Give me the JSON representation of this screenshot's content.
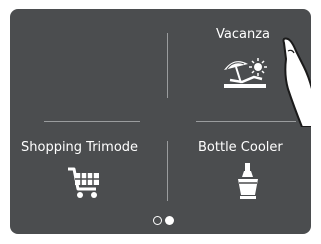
{
  "tiles": [
    {
      "label": "Vacanza",
      "icon": "beach-vacation-icon"
    },
    {
      "label": "Shopping Trimode",
      "icon": "shopping-cart-icon"
    },
    {
      "label": "Bottle Cooler",
      "icon": "bottle-cooler-icon"
    }
  ],
  "pager": {
    "pages": 2,
    "current": 2
  },
  "colors": {
    "background": "#4b4d4f",
    "foreground": "#ffffff",
    "divider": "#9a9c9e"
  }
}
